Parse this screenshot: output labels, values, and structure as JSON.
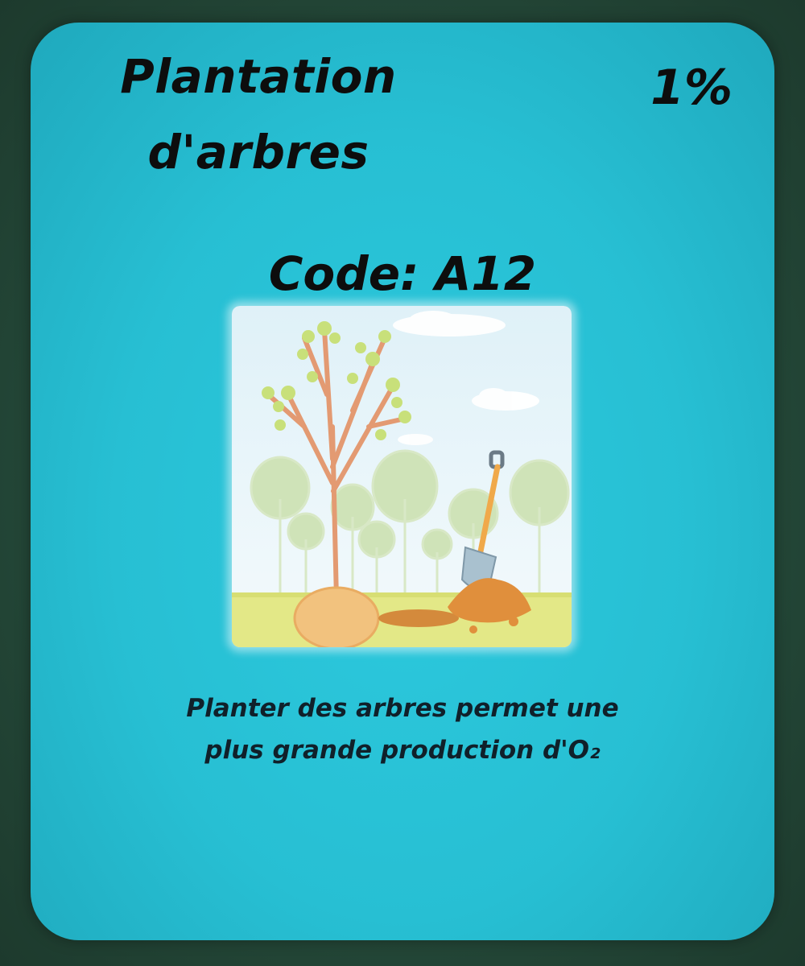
{
  "card": {
    "title_line1": "Plantation",
    "title_line2": "d'arbres",
    "percent": "1%",
    "code": "Code: A12",
    "description_line1": "Planter des arbres permet une",
    "description_line2": "plus grande production d'O₂",
    "illustration_icon": "tree-planting-illustration",
    "colors": {
      "card_background": "#27c3d8",
      "page_background": "#2f5a46",
      "text": "#0d0d0d"
    }
  }
}
